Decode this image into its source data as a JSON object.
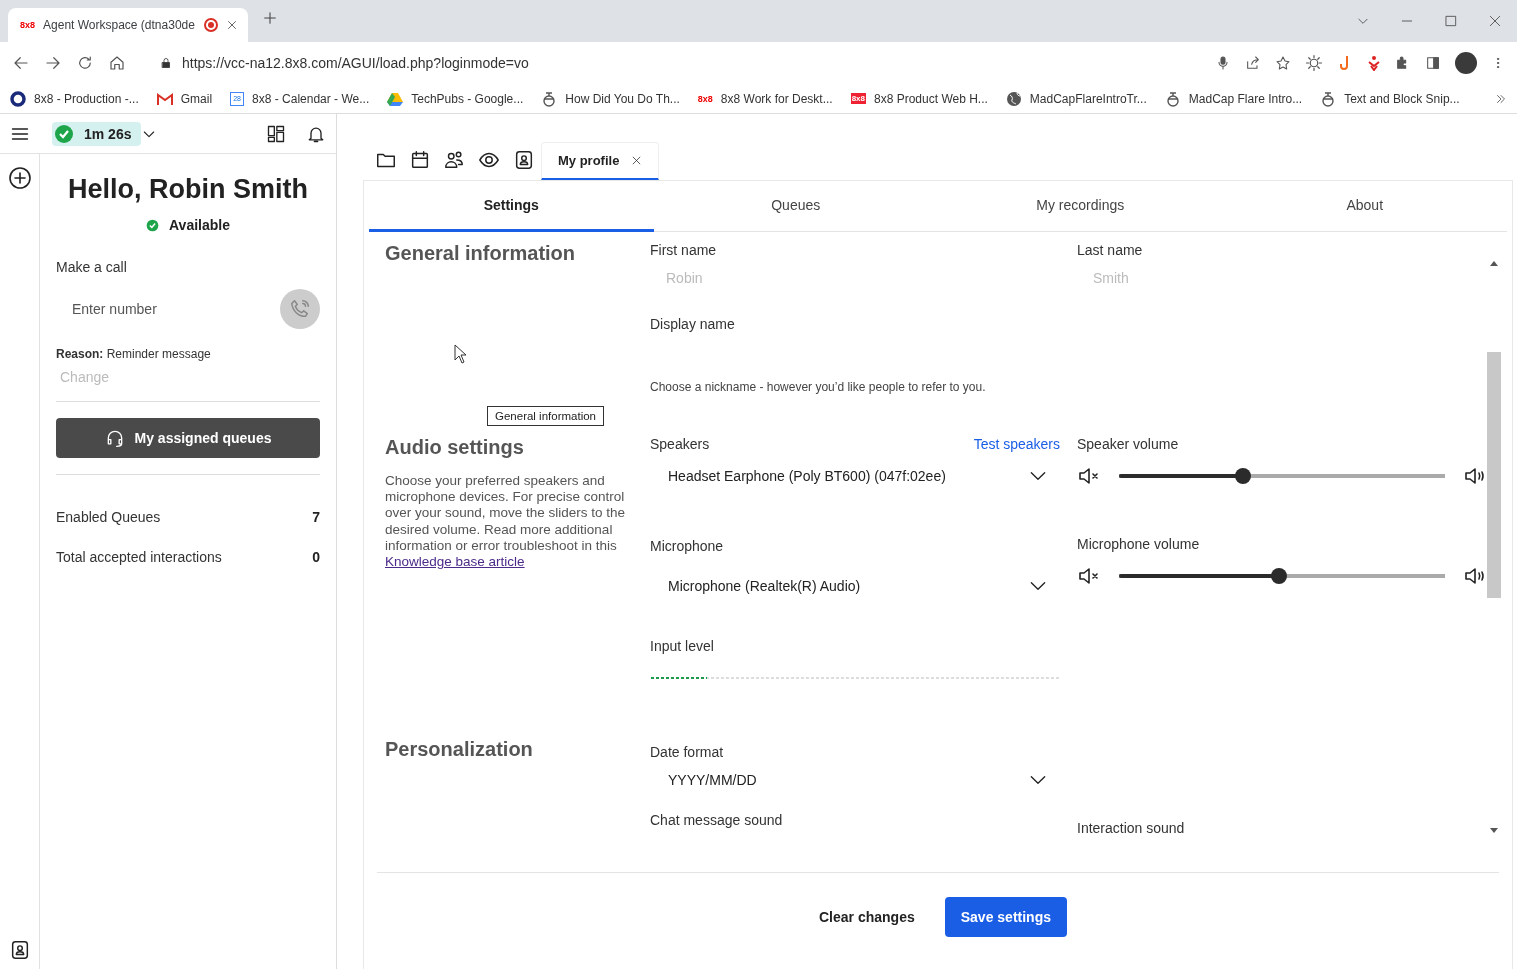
{
  "browser": {
    "tab": {
      "favicon": "8x8",
      "title": "Agent Workspace (dtna30de",
      "recording": true
    },
    "url": "https://vcc-na12.8x8.com/AGUI/load.php?loginmode=vo",
    "bookmarks": [
      {
        "kind": "ring",
        "label": "8x8 - Production -..."
      },
      {
        "kind": "gmail",
        "label": "Gmail"
      },
      {
        "kind": "calendar",
        "icon_text": "28",
        "label": "8x8 - Calendar - We..."
      },
      {
        "kind": "drive",
        "label": "TechPubs - Google..."
      },
      {
        "kind": "propeller",
        "label": "How Did You Do Th..."
      },
      {
        "kind": "brand",
        "icon_text": "8x8",
        "label": "8x8 Work for Deskt..."
      },
      {
        "kind": "brandbox",
        "icon_text": "8x8",
        "label": "8x8 Product Web H..."
      },
      {
        "kind": "globe",
        "label": "MadCapFlareIntroTr..."
      },
      {
        "kind": "propeller",
        "label": "MadCap Flare Intro..."
      },
      {
        "kind": "propeller",
        "label": "Text and Block Snip..."
      }
    ]
  },
  "agent": {
    "timer": "1m 26s",
    "greeting": "Hello, Robin Smith",
    "status": "Available",
    "make_call": {
      "label": "Make a call",
      "placeholder": "Enter number"
    },
    "reason": "**Reason:** Reminder message",
    "change_link": {
      "label": "Change",
      "disabled": true
    },
    "queues_button": "My assigned queues",
    "stats": [
      {
        "label": "Enabled Queues",
        "value": "7"
      },
      {
        "label": "Total accepted interactions",
        "value": "0"
      }
    ]
  },
  "workspace_tabs": [
    {
      "kind": "folder",
      "selected": false
    },
    {
      "kind": "calendar",
      "selected": false
    },
    {
      "kind": "people",
      "selected": false
    },
    {
      "kind": "eye",
      "selected": false
    },
    {
      "kind": "contact",
      "selected": false
    },
    {
      "kind": "label",
      "label": "My profile",
      "closable": true,
      "selected": true
    }
  ],
  "profile_tabs": [
    {
      "label": "Settings",
      "selected": true
    },
    {
      "label": "Queues",
      "selected": false
    },
    {
      "label": "My recordings",
      "selected": false
    },
    {
      "label": "About",
      "selected": false
    }
  ],
  "general": {
    "heading": "General information",
    "first_name": {
      "label": "First name",
      "value": "Robin",
      "disabled": true
    },
    "last_name": {
      "label": "Last name",
      "value": "Smith",
      "disabled": true
    },
    "display_name": {
      "label": "Display name",
      "hint": "Choose a nickname - however you’d like people to refer to you."
    }
  },
  "tooltip": "General information",
  "audio": {
    "heading": "Audio settings",
    "description": "Choose your preferred speakers and microphone devices. For precise control over your sound, move the sliders to the desired volume. Read more additional information or error troubleshoot in this",
    "link": "Knowledge base article",
    "speakers": {
      "label": "Speakers",
      "test_link": "Test speakers",
      "value": "Headset Earphone (Poly BT600) (047f:02ee)"
    },
    "speaker_volume": {
      "label": "Speaker volume",
      "level": 0.38
    },
    "microphone": {
      "label": "Microphone",
      "value": "Microphone (Realtek(R) Audio)"
    },
    "microphone_volume": {
      "label": "Microphone volume",
      "level": 0.49
    },
    "input_level": {
      "label": "Input level",
      "level": 0.14
    }
  },
  "personalization": {
    "heading": "Personalization",
    "date_format": {
      "label": "Date format",
      "value": "YYYY/MM/DD"
    },
    "chat_sound": {
      "label": "Chat message sound"
    },
    "interaction_sound": {
      "label": "Interaction sound"
    }
  },
  "footer": {
    "clear": "Clear changes",
    "save": "Save settings"
  }
}
